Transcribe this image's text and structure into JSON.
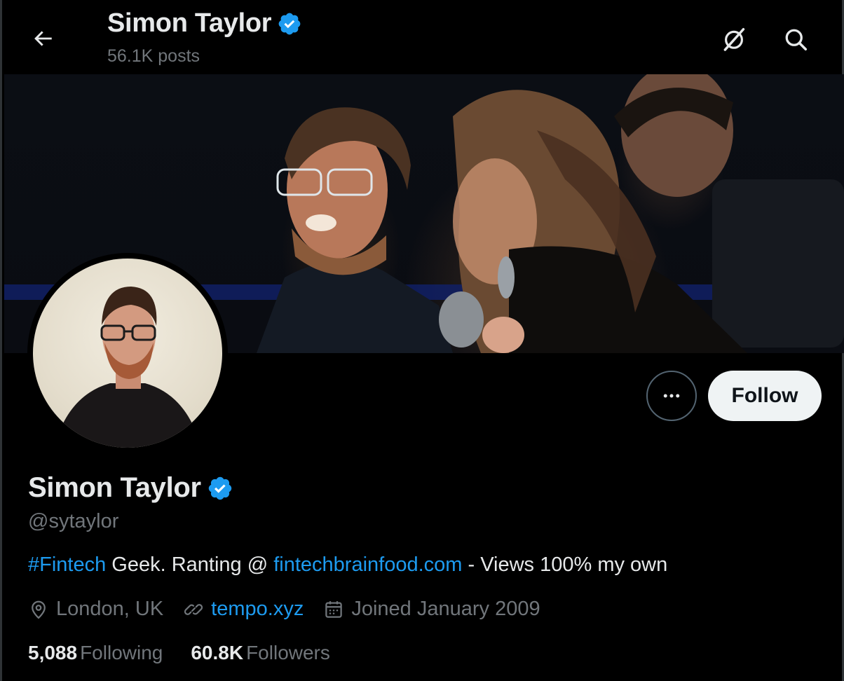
{
  "header": {
    "name": "Simon Taylor",
    "posts": "56.1K posts"
  },
  "actions": {
    "follow_label": "Follow"
  },
  "profile": {
    "name": "Simon Taylor",
    "handle": "@sytaylor",
    "bio": {
      "hashtag": "#Fintech",
      "text1": " Geek. Ranting @ ",
      "link": "fintechbrainfood.com",
      "text2": " - Views 100% my own"
    },
    "location": "London, UK",
    "website": "tempo.xyz",
    "joined": "Joined January 2009"
  },
  "stats": {
    "following_count": "5,088",
    "following_label": "Following",
    "followers_count": "60.8K",
    "followers_label": "Followers"
  },
  "icons": {
    "back": "arrow-left-icon",
    "grok": "grok-icon",
    "search": "search-icon",
    "verified": "verified-badge-icon",
    "more": "more-horizontal-icon",
    "location": "location-pin-icon",
    "link": "link-icon",
    "calendar": "calendar-icon"
  },
  "colors": {
    "accent": "#1d9bf0",
    "background": "#000000",
    "muted_text": "#71767b",
    "primary_text": "#e7e9ea",
    "follow_bg": "#eff3f4"
  }
}
